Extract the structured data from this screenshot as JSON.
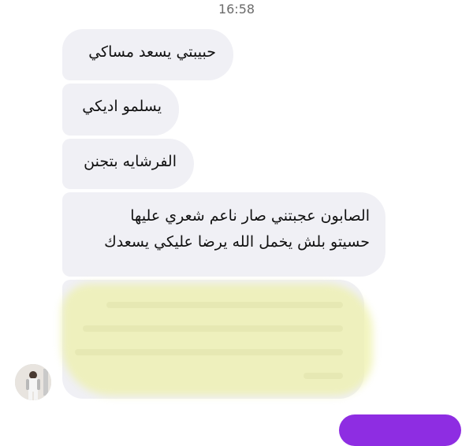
{
  "chat": {
    "timestamp": "16:58",
    "messages": [
      {
        "text": "حبيبتي يسعد مساكي"
      },
      {
        "text": "يسلمو اديكي"
      },
      {
        "text": "الفرشايه بتجنن"
      },
      {
        "lines": [
          "الصابون عجبتني صار ناعم شعري عليها",
          "حسيتو بلش يخمل الله يرضا عليكي يسعدك"
        ]
      }
    ]
  },
  "colors": {
    "incoming_bubble": "#f0f0f5",
    "outgoing_bubble": "#8e2de2",
    "highlight": "#eef0aa"
  },
  "icons": {
    "avatar": "contact-avatar"
  }
}
